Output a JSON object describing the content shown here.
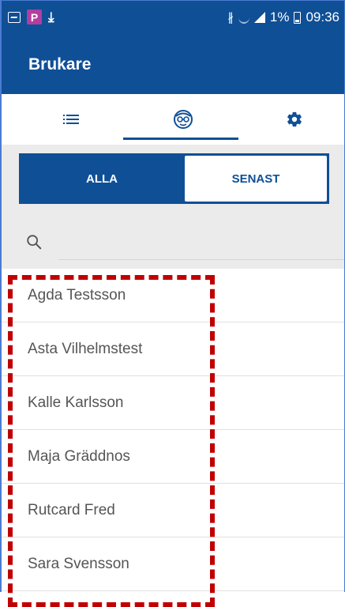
{
  "status": {
    "battery_text": "1%",
    "time": "09:36",
    "icons": [
      "gallery-icon",
      "parking-app-icon",
      "download-icon",
      "bluetooth-icon",
      "wifi-icon",
      "signal-icon",
      "battery-icon"
    ],
    "p_letter": "P"
  },
  "appbar": {
    "title": "Brukare"
  },
  "tabs": [
    {
      "name": "list",
      "icon": "list-icon"
    },
    {
      "name": "users",
      "icon": "elderly-user-icon",
      "active": true
    },
    {
      "name": "settings",
      "icon": "gear-icon"
    }
  ],
  "segment": {
    "all_label": "ALLA",
    "recent_label": "SENAST",
    "selected": "ALLA"
  },
  "search": {
    "placeholder": ""
  },
  "people": [
    "Agda Testsson",
    "Asta Vilhelmstest",
    "Kalle Karlsson",
    "Maja Gräddnos",
    "Rutcard Fred",
    "Sara Svensson"
  ],
  "colors": {
    "primary": "#0f4f96",
    "highlight": "#c00000",
    "background_gray": "#ebebeb"
  }
}
